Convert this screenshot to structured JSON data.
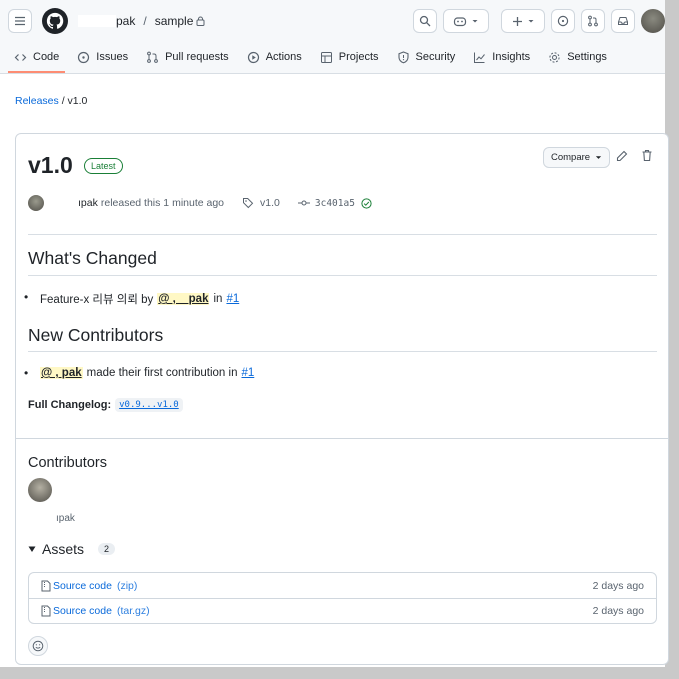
{
  "header": {
    "owner": "pak",
    "separator": "/",
    "repo": "sample"
  },
  "tabs": [
    {
      "label": "Code",
      "icon": "code-icon",
      "active": true
    },
    {
      "label": "Issues",
      "icon": "issue-icon"
    },
    {
      "label": "Pull requests",
      "icon": "pull-request-icon"
    },
    {
      "label": "Actions",
      "icon": "play-icon"
    },
    {
      "label": "Projects",
      "icon": "table-icon"
    },
    {
      "label": "Security",
      "icon": "shield-icon"
    },
    {
      "label": "Insights",
      "icon": "graph-icon"
    },
    {
      "label": "Settings",
      "icon": "gear-icon"
    }
  ],
  "breadcrumb": {
    "releases": "Releases",
    "sep": "/",
    "current": "v1.0"
  },
  "release": {
    "title": "v1.0",
    "badge": "Latest",
    "compare": "Compare",
    "author": "ıpak",
    "released_text": "released this 1 minute ago",
    "tag": "v1.0",
    "commit": "3c401a5"
  },
  "body": {
    "whats_changed": "What's Changed",
    "item1_text": "Feature-x 리뷰 의뢰 by",
    "item1_mention": "@ ,  _ pak",
    "item1_in": "in",
    "item1_link": "#1",
    "new_contributors": "New Contributors",
    "item2_mention": "@ ,        pak",
    "item2_text": "made their first contribution in",
    "item2_link": "#1",
    "changelog_label": "Full Changelog:",
    "changelog_link": "v0.9...v1.0"
  },
  "contributors": {
    "title": "Contributors",
    "name": "ıpak"
  },
  "assets": {
    "title": "Assets",
    "count": "2",
    "items": [
      {
        "name": "Source code",
        "ext": "(zip)",
        "date": "2 days ago"
      },
      {
        "name": "Source code",
        "ext": "(tar.gz)",
        "date": "2 days ago"
      }
    ]
  }
}
